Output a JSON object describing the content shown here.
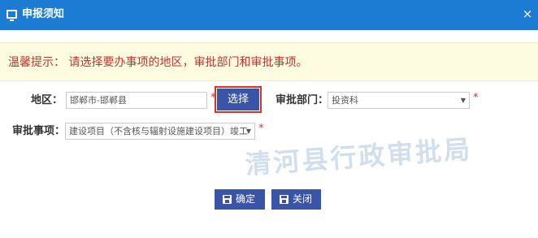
{
  "dialog": {
    "title": "申报须知",
    "close_label": "×"
  },
  "notice": {
    "text": "温馨提示： 请选择要办事项的地区，审批部门和审批事项。"
  },
  "form": {
    "region_label": "地区：",
    "region_value": "邯郸市-邯郸县",
    "region_required": "*",
    "choose_button": "选择",
    "department_label": "审批部门：",
    "department_value": "投资科",
    "department_required": "*",
    "item_label": "审批事项：",
    "item_value": "建设项目（不含核与辐射设施建设项目）竣工",
    "item_required": "*"
  },
  "icons": {
    "window": "monitor-icon",
    "close": "close-icon",
    "save": "floppy-icon",
    "dropdown": "caret-down-icon"
  },
  "actions": {
    "confirm_label": "确定",
    "close_label": "关闭"
  },
  "watermark": {
    "text": "清河县行政审批局"
  },
  "colors": {
    "titlebar": "#1c7bd3",
    "button": "#3a54a8",
    "notice_bg": "#fdfce1",
    "notice_text": "#c9302c",
    "highlight_border": "#d9302c"
  }
}
